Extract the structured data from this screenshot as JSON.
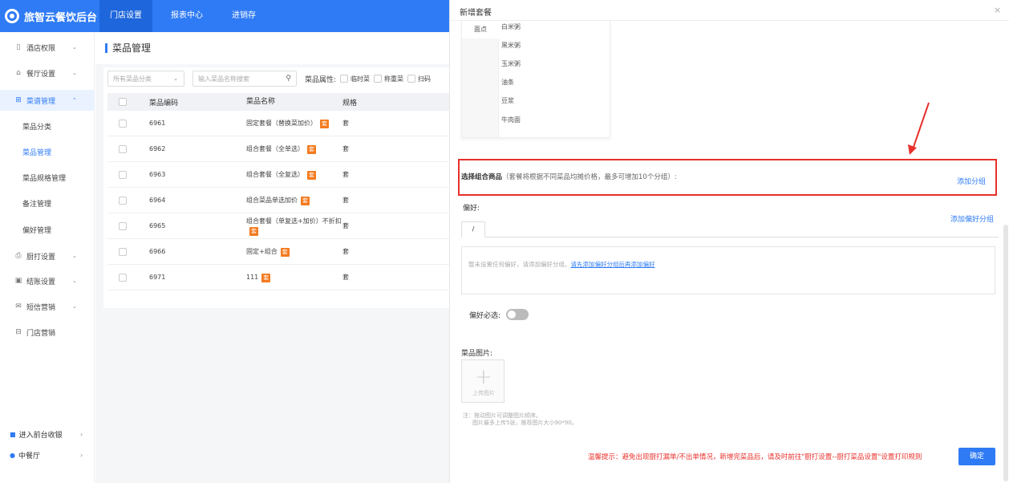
{
  "brand": {
    "name": "旅智云餐饮后台"
  },
  "topnav": {
    "tabs": [
      {
        "label": "门店设置"
      },
      {
        "label": "报表中心"
      },
      {
        "label": "进销存"
      }
    ]
  },
  "sidebar": {
    "items": [
      {
        "label": "酒店权限"
      },
      {
        "label": "餐厅设置"
      },
      {
        "label": "菜谱管理"
      },
      {
        "label": "厨打设置"
      },
      {
        "label": "结账设置"
      },
      {
        "label": "短信营销"
      },
      {
        "label": "门店营销"
      }
    ],
    "sub_items": [
      {
        "label": "菜品分类"
      },
      {
        "label": "菜品管理"
      },
      {
        "label": "菜品规格管理"
      },
      {
        "label": "备注管理"
      },
      {
        "label": "偏好管理"
      }
    ],
    "footer": [
      {
        "label": "进入前台收银"
      },
      {
        "label": "中餐厅"
      }
    ]
  },
  "main": {
    "title": "菜品管理",
    "filter": {
      "category_placeholder": "所有菜品分类",
      "search_placeholder": "输入菜品名称搜索",
      "attr_label": "菜品属性:",
      "options": [
        "临时菜",
        "称重菜",
        "扫码"
      ]
    },
    "table": {
      "headers": [
        "菜品编码",
        "菜品名称",
        "规格"
      ],
      "rows": [
        {
          "code": "6961",
          "name": "固定套餐（替换菜加价）",
          "tag": "套",
          "spec": "套"
        },
        {
          "code": "6962",
          "name": "组合套餐（全单选）",
          "tag": "套",
          "spec": "套"
        },
        {
          "code": "6963",
          "name": "组合套餐（全复选）",
          "tag": "套",
          "spec": "套"
        },
        {
          "code": "6964",
          "name": "组合菜品单选加价",
          "tag": "套",
          "spec": "套"
        },
        {
          "code": "6965",
          "name": "组合套餐（单复选+加价）不折扣",
          "tag": "套",
          "spec": "套"
        },
        {
          "code": "6966",
          "name": "固定+组合",
          "tag": "套",
          "spec": "套"
        },
        {
          "code": "6971",
          "name": "111",
          "tag": "套",
          "spec": "套"
        }
      ]
    }
  },
  "drawer": {
    "title": "新增套餐",
    "menu": {
      "category": "面点",
      "items": [
        "白米粥",
        "黑米粥",
        "玉米粥",
        "油条",
        "豆浆",
        "牛肉面"
      ]
    },
    "combo": {
      "label": "选择组合商品",
      "hint": "（套餐将根据不同菜品均摊价格，最多可增加10个分组）:",
      "add_group": "添加分组"
    },
    "preference": {
      "label": "偏好:",
      "add_group": "添加偏好分组",
      "tab": "/",
      "empty_text": "暂未设置任何偏好，请添加偏好分组。",
      "empty_link": "请先添加偏好分组后再添加偏好"
    },
    "must_select": {
      "label": "偏好必选:"
    },
    "image": {
      "label": "菜品图片:",
      "upload_text": "上传图片",
      "note_line1": "注：拖动图片可调整图片顺序。",
      "note_line2": "图片最多上传5张，推荐图片大小90*90。"
    },
    "tip": "温馨提示：避免出现厨打漏单/不出单情况，新增完菜品后，请及时前往\"厨打设置--厨打菜品设置\"设置打印规则",
    "confirm": "确定"
  },
  "colors": {
    "primary": "#2f7bf5",
    "highlight": "#e8302b",
    "tag": "#f47b20"
  }
}
